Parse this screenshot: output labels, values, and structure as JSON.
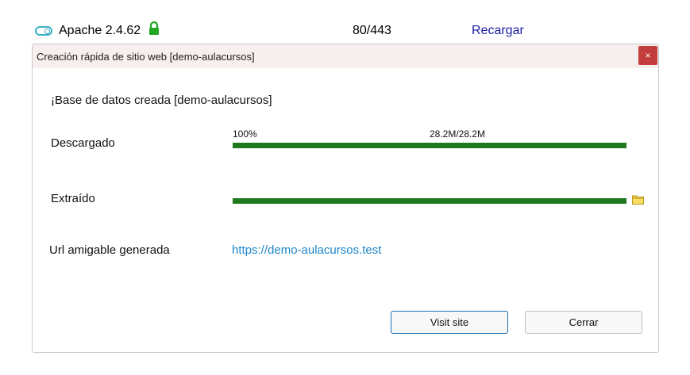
{
  "topbar": {
    "server_name": "Apache 2.4.62",
    "counter": "80/443",
    "reload_label": "Recargar",
    "toggle_icon": "toggle-on-icon",
    "lock_icon": "lock-icon"
  },
  "dialog": {
    "title": "Creación rápida de sitio web [demo-aulacursos]",
    "close_label": "×",
    "status_message": "¡Base de datos creada [demo-aulacursos]",
    "download": {
      "label": "Descargado",
      "percent_text": "100%",
      "size_text": "28.2M/28.2M",
      "progress": 1.0
    },
    "extract": {
      "label": "Extraído",
      "progress": 1.0,
      "folder_icon": "folder-icon"
    },
    "url": {
      "label": "Url amigable generada",
      "value": "https://demo-aulacursos.test"
    },
    "buttons": {
      "visit_label": "Visit site",
      "close_label": "Cerrar"
    }
  },
  "colors": {
    "progress_fill": "#1f7a1f",
    "link": "#1e88c8",
    "reload_link": "#1a1aa6",
    "close_button": "#c43d3d",
    "header_bg": "#f7eeee",
    "lock_green": "#22a822",
    "toggle_accent": "#3ab0c8"
  }
}
